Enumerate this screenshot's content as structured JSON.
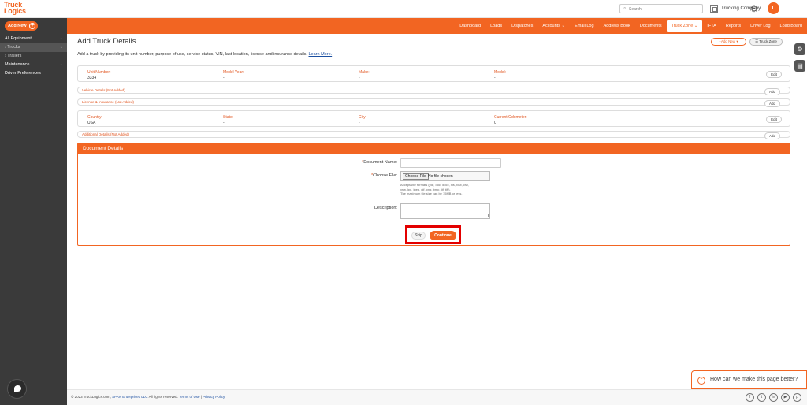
{
  "brand": {
    "logo_line1": "Truck",
    "logo_line2": "Logics"
  },
  "header": {
    "search_placeholder": "Search",
    "company_name": "Trucking Company",
    "avatar_initial": "L"
  },
  "sidebar": {
    "add_new": "Add New",
    "items": [
      {
        "label": "All Equipment",
        "chev": "⌄"
      },
      {
        "label": "Trucks",
        "chev": "⌄"
      },
      {
        "label": "Trailers"
      },
      {
        "label": "Maintenance",
        "chev": "⌄"
      },
      {
        "label": "Driver Preferences"
      }
    ]
  },
  "nav": {
    "links": [
      "Dashboard",
      "Loads",
      "Dispatches",
      "Accounts ⌄",
      "Email Log",
      "Address Book",
      "Documents",
      "Truck Zone ⌄",
      "IFTA",
      "Reports",
      "Driver Log",
      "Load Board"
    ],
    "active": "Truck Zone ⌄"
  },
  "page": {
    "title": "Add Truck Details",
    "description": "Add a truck by providing its unit number, purpose of use, service status, VIN, last location, license and insurance details.",
    "learn_more": "Learn More.",
    "add_new_pill": "+Add New ▾",
    "truck_zone_pill": "☰ Truck Zone"
  },
  "summary": {
    "row1": [
      {
        "label": "Unit Number:",
        "value": "3334"
      },
      {
        "label": "Model Year:",
        "value": "-"
      },
      {
        "label": "Make:",
        "value": "-"
      },
      {
        "label": "Model:",
        "value": "-"
      }
    ],
    "row2": [
      {
        "label": "Country:",
        "value": "USA"
      },
      {
        "label": "State:",
        "value": "-"
      },
      {
        "label": "City:",
        "value": "-"
      },
      {
        "label": "Current Odometer:",
        "value": "0"
      }
    ],
    "edit_label": "Edit",
    "add_label": "Add",
    "vehicle_details": "Vehicle Details (Not Added)",
    "license_insurance": "License & Insurance (Not Added)",
    "additional_details": "Additional Details (Not Added)"
  },
  "document": {
    "header": "Document Details",
    "name_label": "Document Name:",
    "file_label": "Choose File:",
    "file_button": "Choose File",
    "file_status": "No file chosen",
    "help_line1": "Acceptable formats (pdf, doc, docx, xls, xlsx, csv,",
    "help_line2": "xsw, jpg, jpeg, gif, png, bmp, tif, tiff).",
    "help_line3": "The maximum file size can be 15MB or less.",
    "description_label": "Description:",
    "skip": "Skip",
    "continue": "Continue"
  },
  "feedback": {
    "text": "How can we make this page better?"
  },
  "footer": {
    "copyright": "© 2023 TruckLogics.com,",
    "company_link": "SPAN Enterprises LLC",
    "rights": "All rights reserved.",
    "terms": "Terms of Use",
    "separator": "|",
    "privacy": "Privacy Policy"
  },
  "colors": {
    "brand": "#f26522",
    "sidebar": "#3a3a3a",
    "highlight": "#e30000"
  }
}
